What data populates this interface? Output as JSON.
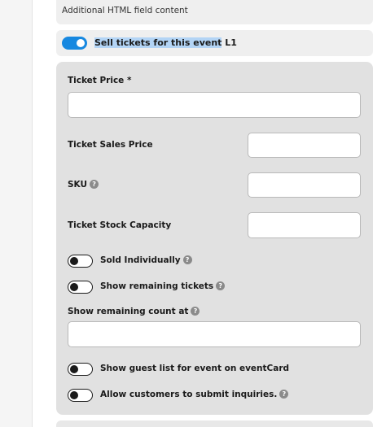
{
  "additional_html": {
    "text": "Additional HTML field content"
  },
  "sell_toggle": {
    "label_highlighted": "Sell tickets for this event",
    "label_rest": " L1",
    "state": "on"
  },
  "fields": {
    "ticket_price": {
      "label": "Ticket Price *",
      "value": ""
    },
    "ticket_sales_price": {
      "label": "Ticket Sales Price",
      "value": ""
    },
    "sku": {
      "label": "SKU",
      "value": ""
    },
    "ticket_stock_capacity": {
      "label": "Ticket Stock Capacity",
      "value": ""
    },
    "show_remaining_count_at": {
      "label": "Show remaining count at",
      "value": ""
    }
  },
  "toggles": {
    "sold_individually": {
      "label": "Sold Individually",
      "state": "off"
    },
    "show_remaining_tickets": {
      "label": "Show remaining tickets",
      "state": "off"
    },
    "show_guest_list": {
      "label": "Show guest list for event on eventCard",
      "state": "off"
    },
    "allow_inquiries": {
      "label": "Allow customers to submit inquiries.",
      "state": "off"
    }
  },
  "help_glyph": "?",
  "colors": {
    "toggle_on": "#1788e0",
    "panel_bg": "#e1e1e1",
    "selection": "#b3d4f5"
  }
}
